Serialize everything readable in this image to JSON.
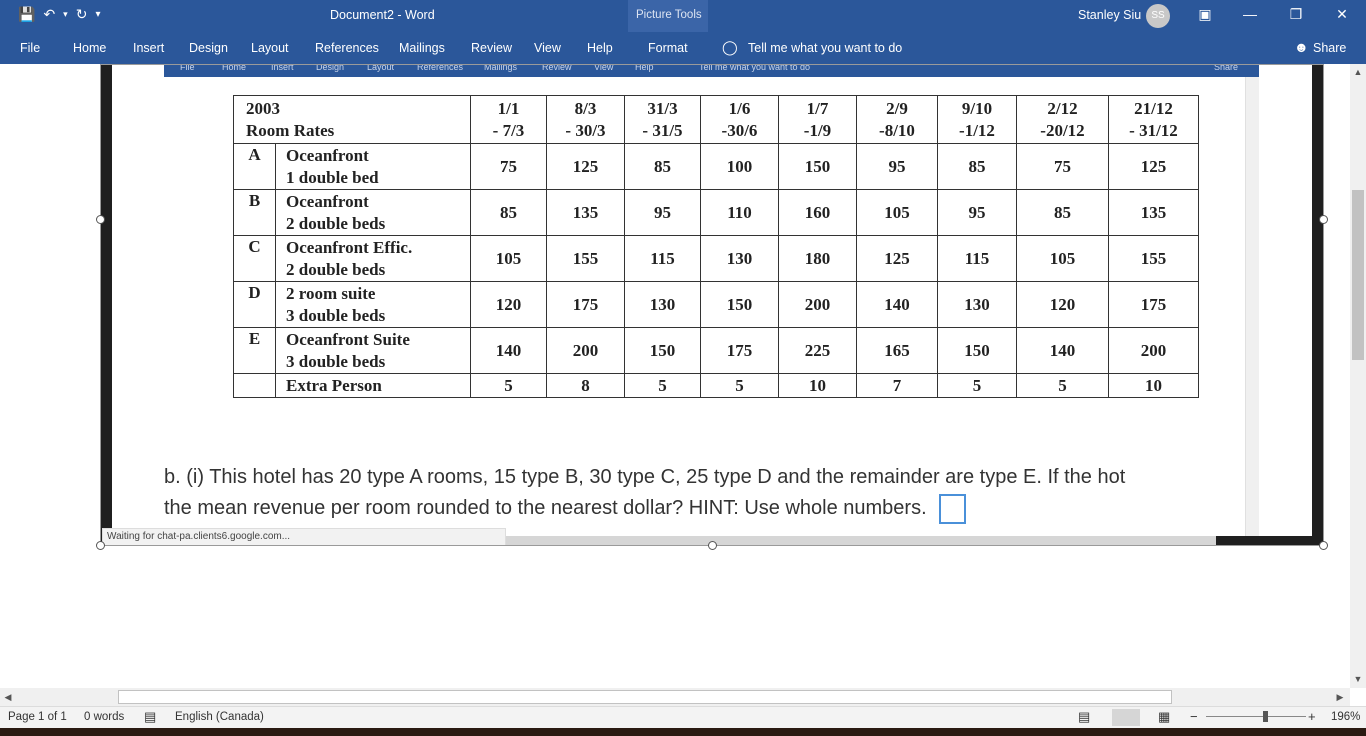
{
  "titlebar": {
    "doc_title": "Document2  -  Word",
    "context_group": "Picture Tools",
    "user_name": "Stanley Siu",
    "user_initials": "SS",
    "save_icon": "save-icon",
    "undo_icon": "undo-icon",
    "redo_icon": "redo-icon"
  },
  "ribbon": {
    "tabs": [
      "File",
      "Home",
      "Insert",
      "Design",
      "Layout",
      "References",
      "Mailings",
      "Review",
      "View",
      "Help",
      "Format"
    ],
    "tell_me": "Tell me what you want to do",
    "share": "Share"
  },
  "embedded_ribbon": {
    "tabs": [
      "File",
      "Home",
      "Insert",
      "Design",
      "Layout",
      "References",
      "Mailings",
      "Review",
      "View",
      "Help"
    ],
    "tell_me": "Tell me what you want to do",
    "share": "Share"
  },
  "rate_table": {
    "title_line1": "2003",
    "title_line2": "Room Rates",
    "periods": [
      [
        "1/1",
        "- 7/3"
      ],
      [
        "8/3",
        "- 30/3"
      ],
      [
        "31/3",
        "- 31/5"
      ],
      [
        "1/6",
        "-30/6"
      ],
      [
        "1/7",
        "-1/9"
      ],
      [
        "2/9",
        "-8/10"
      ],
      [
        "9/10",
        "-1/12"
      ],
      [
        "2/12",
        "-20/12"
      ],
      [
        "21/12",
        "- 31/12"
      ]
    ],
    "rows": [
      {
        "code": "A",
        "name1": "Oceanfront",
        "name2": "1 double bed",
        "values": [
          "75",
          "125",
          "85",
          "100",
          "150",
          "95",
          "85",
          "75",
          "125"
        ]
      },
      {
        "code": "B",
        "name1": "Oceanfront",
        "name2": "2 double beds",
        "values": [
          "85",
          "135",
          "95",
          "110",
          "160",
          "105",
          "95",
          "85",
          "135"
        ]
      },
      {
        "code": "C",
        "name1": "Oceanfront Effic.",
        "name2": "2 double beds",
        "values": [
          "105",
          "155",
          "115",
          "130",
          "180",
          "125",
          "115",
          "105",
          "155"
        ]
      },
      {
        "code": "D",
        "name1": "2 room suite",
        "name2": "3 double beds",
        "values": [
          "120",
          "175",
          "130",
          "150",
          "200",
          "140",
          "130",
          "120",
          "175"
        ]
      },
      {
        "code": "E",
        "name1": "Oceanfront Suite",
        "name2": "3 double beds",
        "values": [
          "140",
          "200",
          "150",
          "175",
          "225",
          "165",
          "150",
          "140",
          "200"
        ]
      }
    ],
    "extra": {
      "label": "Extra Person",
      "values": [
        "5",
        "8",
        "5",
        "5",
        "10",
        "7",
        "5",
        "5",
        "10"
      ]
    }
  },
  "question": {
    "line1": "b. (i) This hotel has 20 type A rooms, 15 type B, 30 type C, 25 type D and the remainder are type E.  If the hot",
    "line2": "the mean revenue per room rounded to the nearest dollar? HINT: Use whole numbers."
  },
  "loading_text": "Waiting for chat-pa.clients6.google.com...",
  "statusbar": {
    "page": "Page 1 of 1",
    "words": "0 words",
    "language": "English (Canada)",
    "zoom": "196%"
  }
}
